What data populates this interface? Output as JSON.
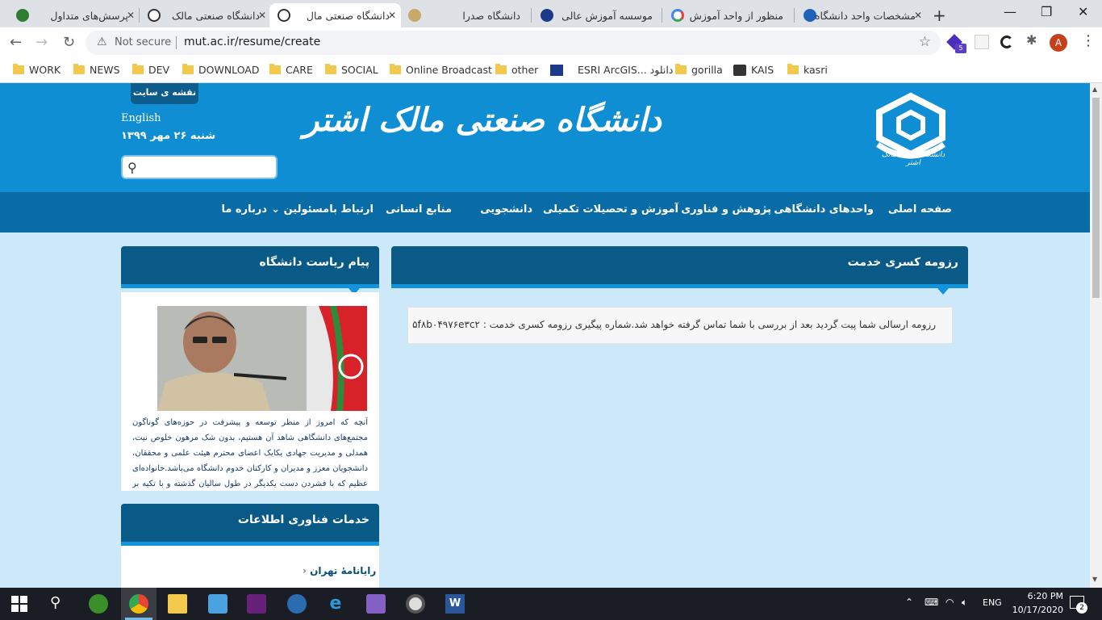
{
  "browser": {
    "tabs": [
      {
        "label": "پرسش‌های متداول",
        "active": false
      },
      {
        "label": "دانشگاه صنعتی مالک",
        "active": false
      },
      {
        "label": "دانشگاه صنعتی مال",
        "active": true
      },
      {
        "label": "دانشگاه صدرا",
        "active": false
      },
      {
        "label": "موسسه آموزش عالی",
        "active": false
      },
      {
        "label": "منظور از واحد آموزش",
        "active": false
      },
      {
        "label": "مشخصات واحد دانشگاه",
        "active": false
      }
    ],
    "security_label": "Not secure",
    "url": "mut.ac.ir/resume/create",
    "avatar_letter": "A",
    "extension_badge": "5",
    "bookmarks": [
      "WORK",
      "NEWS",
      "DEV",
      "DOWNLOAD",
      "CARE",
      "SOCIAL",
      "Online Broadcast",
      "other",
      "ESRI ArcGIS... دانلود",
      "gorilla",
      "KAIS",
      "kasri"
    ]
  },
  "site": {
    "sitemap_label": "نقشه ی سایت",
    "english_link": "English",
    "date": "شنبه ۲۶ مهر ۱۳۹۹",
    "title": "دانشگاه صنعتی مالک اشتر",
    "logo_text": "دانشگاه صنعتی مالک اشتر",
    "search_placeholder": "",
    "nav": [
      "صفحه اصلی",
      "واحدهای دانشگاهی",
      "پژوهش و فناوری",
      "آموزش و تحصیلات تکمیلی",
      "دانشجویی",
      "منابع انسانی",
      "ارتباط بامسئولین",
      "درباره ما"
    ]
  },
  "main_panel": {
    "heading": "رزومه کسری خدمت",
    "message": "رزومه ارسالی شما پیت گردید بعد از بررسی با شما تماس گرفته خواهد شد.شماره پیگیری رزومه کسری خدمت : ۵f۸b۰۴۹۷۶e۳c۲"
  },
  "president_panel": {
    "heading": "پیام ریاست دانشگاه",
    "text": "آنچه که امروز از منظر توسعه و پیشرفت در حوزه‌های گوناگون مجتمع‌های دانشگاهی شاهد آن هستیم، بدون شک مرهون خلوص نیت، همدلی و مدیریت جهادی یکایک اعضای محترم هیئت علمی و محققان، دانشجویان معزز و مدیران و کارکنان خدوم دانشگاه می‌باشد.خانواده‌ای عظیم که با فشردن دست یکدیگر در طول سالیان گذشته و با تکیه بر خدمات مدیران و"
  },
  "it_panel": {
    "heading": "خدمات فناوری اطلاعات",
    "link": "رایانامهٔ تهران"
  },
  "taskbar": {
    "language": "ENG",
    "time": "6:20 PM",
    "date": "10/17/2020",
    "notifications": "2"
  }
}
